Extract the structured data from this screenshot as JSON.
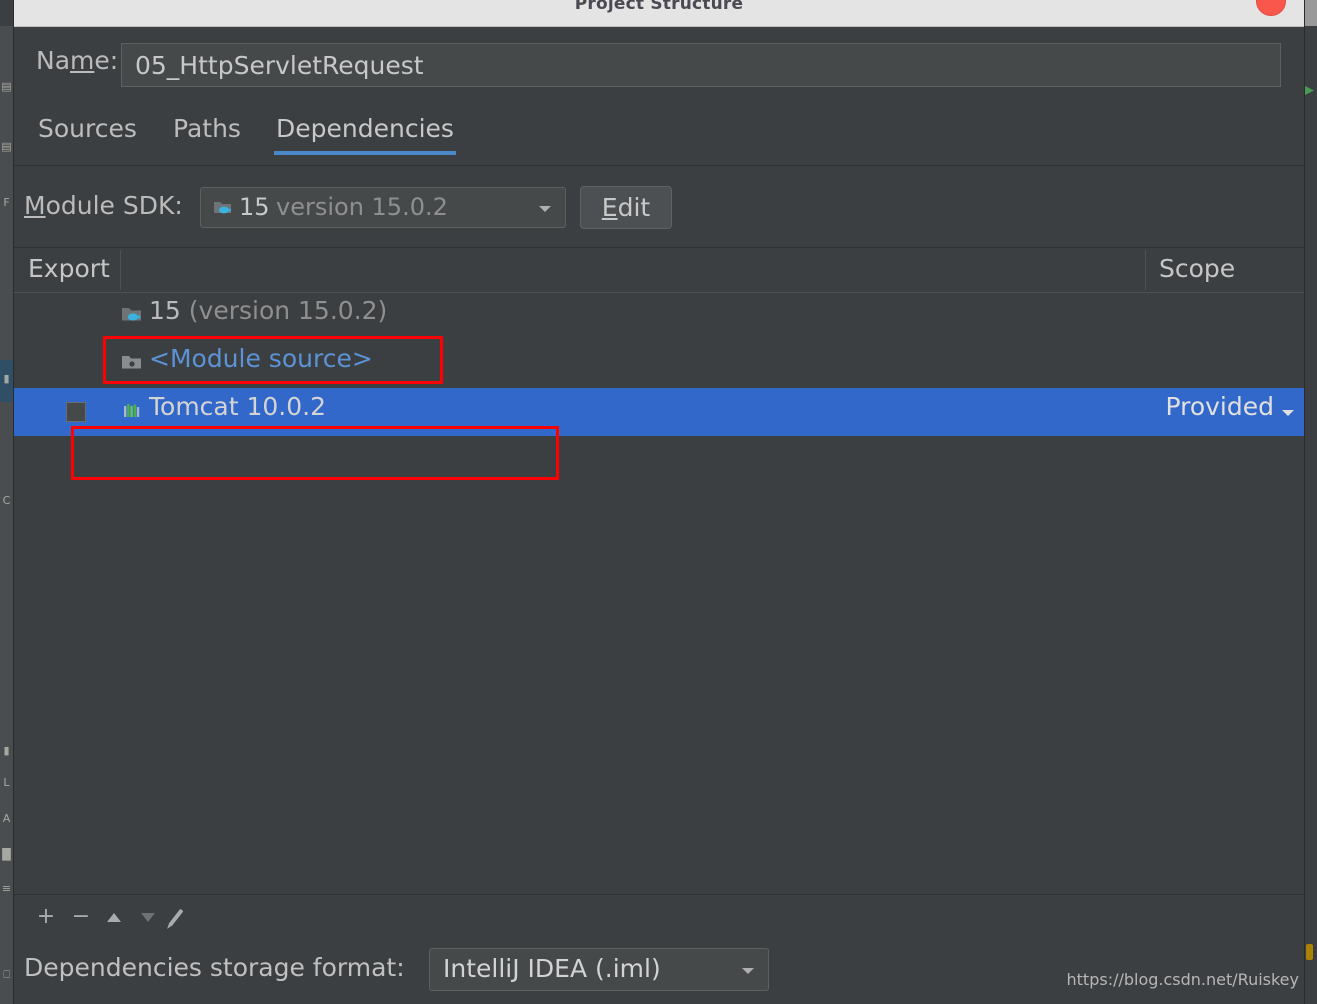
{
  "window": {
    "title": "Project Structure",
    "close_icon": "close-circle-icon"
  },
  "name_field": {
    "label": "Name:",
    "label_mnemonic": "m",
    "value": "05_HttpServletRequest"
  },
  "tabs": [
    {
      "label": "Sources",
      "active": false
    },
    {
      "label": "Paths",
      "active": false
    },
    {
      "label": "Dependencies",
      "active": true
    }
  ],
  "module_sdk": {
    "label": "Module SDK:",
    "label_mnemonic": "M",
    "icon": "jdk-folder-icon",
    "name": "15",
    "version": "version 15.0.2",
    "dropdown_icon": "chevron-down-icon",
    "edit_button": "Edit",
    "edit_mnemonic": "E"
  },
  "table": {
    "columns": [
      {
        "label": "Export"
      },
      {
        "label": ""
      },
      {
        "label": "Scope"
      }
    ],
    "rows": [
      {
        "icon": "jdk-folder-icon",
        "name": "15",
        "name_suffix": "(version 15.0.2)",
        "scope": "",
        "selected": false,
        "has_checkbox": false,
        "kind": "sdk"
      },
      {
        "icon": "module-source-folder-icon",
        "name": "<Module source>",
        "name_suffix": "",
        "scope": "",
        "selected": false,
        "has_checkbox": false,
        "kind": "modsrc"
      },
      {
        "icon": "library-icon",
        "name": "Tomcat 10.0.2",
        "name_suffix": "",
        "scope": "Provided",
        "selected": true,
        "has_checkbox": true,
        "kind": "lib"
      }
    ]
  },
  "toolbar": {
    "add": "+",
    "remove": "−",
    "move_up_icon": "arrow-up-icon",
    "move_down_icon": "arrow-down-icon",
    "edit_icon": "pencil-icon"
  },
  "storage_format": {
    "label": "Dependencies storage format:",
    "value": "IntelliJ IDEA (.iml)",
    "dropdown_icon": "chevron-down-icon"
  },
  "watermark": "https://blog.csdn.net/Ruiskey",
  "background_strip": {
    "left_glyphs": [
      "☰",
      "☷",
      "⊑",
      "‖",
      "C",
      "▮",
      "L",
      "A",
      "▒",
      "≡",
      "⌗"
    ],
    "right_glyphs": []
  },
  "colors": {
    "accent_blue": "#4a88c7",
    "selection_blue": "#3268c9",
    "annotation_red": "#ff0000",
    "link_blue": "#5b93d6",
    "close_red": "#f9574c",
    "panel_bg": "#3c3f41",
    "field_bg": "#45494a"
  }
}
